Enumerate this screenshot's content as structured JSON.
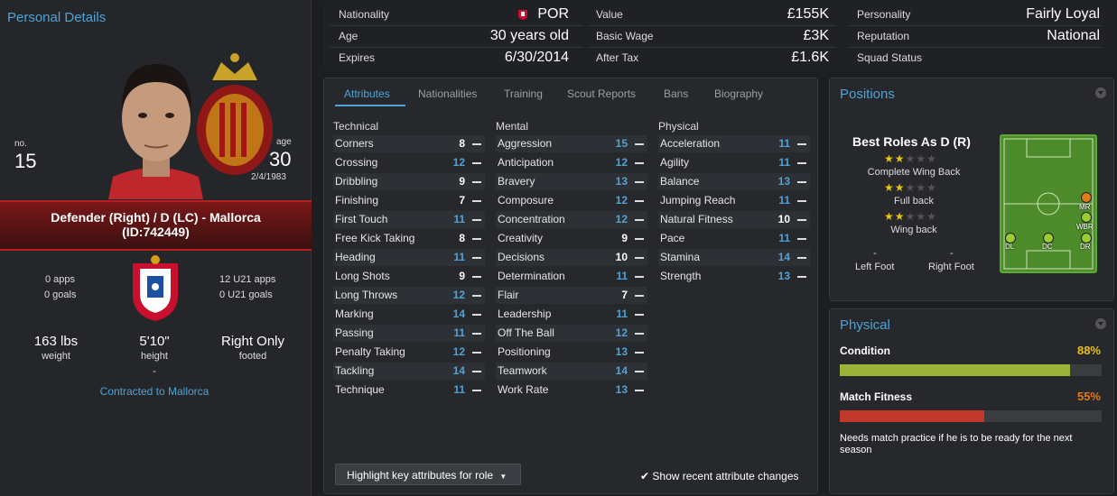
{
  "left": {
    "title": "Personal Details",
    "no_label": "no.",
    "number": "15",
    "age_label": "age",
    "age": "30",
    "dob": "2/4/1983",
    "role_line1": "Defender (Right) / D (LC) - Mallorca",
    "role_line2": "(ID:742449)",
    "apps": "0 apps",
    "goals": "0 goals",
    "u21_apps": "12 U21 apps",
    "u21_goals": "0 U21 goals",
    "weight": "163 lbs",
    "weight_label": "weight",
    "height": "5'10\"",
    "height_label": "height",
    "foot": "Right Only",
    "foot_label": "footed",
    "dash": "-",
    "contract": "Contracted to Mallorca"
  },
  "top": {
    "nationality_label": "Nationality",
    "nationality": "POR",
    "age_label": "Age",
    "age": "30 years old",
    "expires_label": "Expires",
    "expires": "6/30/2014",
    "value_label": "Value",
    "value": "£155K",
    "wage_label": "Basic Wage",
    "wage": "£3K",
    "aftertax_label": "After Tax",
    "aftertax": "£1.6K",
    "personality_label": "Personality",
    "personality": "Fairly Loyal",
    "reputation_label": "Reputation",
    "reputation": "National",
    "squad_label": "Squad Status",
    "squad": ""
  },
  "tabs": [
    "Attributes",
    "Nationalities",
    "Training",
    "Scout Reports",
    "Bans",
    "Biography"
  ],
  "columns": {
    "technical": {
      "title": "Technical",
      "rows": [
        {
          "name": "Corners",
          "value": "8"
        },
        {
          "name": "Crossing",
          "value": "12"
        },
        {
          "name": "Dribbling",
          "value": "9"
        },
        {
          "name": "Finishing",
          "value": "7"
        },
        {
          "name": "First Touch",
          "value": "11"
        },
        {
          "name": "Free Kick Taking",
          "value": "8"
        },
        {
          "name": "Heading",
          "value": "11"
        },
        {
          "name": "Long Shots",
          "value": "9"
        },
        {
          "name": "Long Throws",
          "value": "12"
        },
        {
          "name": "Marking",
          "value": "14"
        },
        {
          "name": "Passing",
          "value": "11"
        },
        {
          "name": "Penalty Taking",
          "value": "12"
        },
        {
          "name": "Tackling",
          "value": "14"
        },
        {
          "name": "Technique",
          "value": "11"
        }
      ]
    },
    "mental": {
      "title": "Mental",
      "rows": [
        {
          "name": "Aggression",
          "value": "15"
        },
        {
          "name": "Anticipation",
          "value": "12"
        },
        {
          "name": "Bravery",
          "value": "13"
        },
        {
          "name": "Composure",
          "value": "12"
        },
        {
          "name": "Concentration",
          "value": "12"
        },
        {
          "name": "Creativity",
          "value": "9"
        },
        {
          "name": "Decisions",
          "value": "10"
        },
        {
          "name": "Determination",
          "value": "11"
        },
        {
          "name": "Flair",
          "value": "7"
        },
        {
          "name": "Leadership",
          "value": "11"
        },
        {
          "name": "Off The Ball",
          "value": "12"
        },
        {
          "name": "Positioning",
          "value": "13"
        },
        {
          "name": "Teamwork",
          "value": "14"
        },
        {
          "name": "Work Rate",
          "value": "13"
        }
      ]
    },
    "physical": {
      "title": "Physical",
      "rows": [
        {
          "name": "Acceleration",
          "value": "11"
        },
        {
          "name": "Agility",
          "value": "11"
        },
        {
          "name": "Balance",
          "value": "13"
        },
        {
          "name": "Jumping Reach",
          "value": "11"
        },
        {
          "name": "Natural Fitness",
          "value": "10"
        },
        {
          "name": "Pace",
          "value": "11"
        },
        {
          "name": "Stamina",
          "value": "14"
        },
        {
          "name": "Strength",
          "value": "13"
        }
      ]
    }
  },
  "highlight_button": "Highlight key attributes for role",
  "show_recent": "Show recent attribute changes",
  "positions": {
    "title": "Positions",
    "best_roles": "Best Roles As D (R)",
    "roles": [
      {
        "name": "Complete Wing Back",
        "stars": 2,
        "max": 5
      },
      {
        "name": "Full back",
        "stars": 2,
        "max": 5
      },
      {
        "name": "Wing back",
        "stars": 2,
        "max": 5
      }
    ],
    "left_foot_value": "-",
    "left_foot": "Left Foot",
    "right_foot_value": "-",
    "right_foot": "Right Foot",
    "pitch_labels": {
      "mr": "MR",
      "wbr": "WBR",
      "dl": "DL",
      "dc": "DC",
      "dr": "DR"
    },
    "colors": {
      "natural": "#9acd32",
      "accomplished": "#e07b1a"
    }
  },
  "physical": {
    "title": "Physical",
    "condition_label": "Condition",
    "condition": "88%",
    "condition_value": 0.88,
    "fitness_label": "Match Fitness",
    "fitness": "55%",
    "fitness_value": 0.55,
    "note": "Needs match practice if he is to be ready for the next season",
    "colors": {
      "condition": "#9ab338",
      "fitness": "#c0392b",
      "fitness_text": "#e07b1a",
      "condition_text": "#e9c21a"
    }
  }
}
